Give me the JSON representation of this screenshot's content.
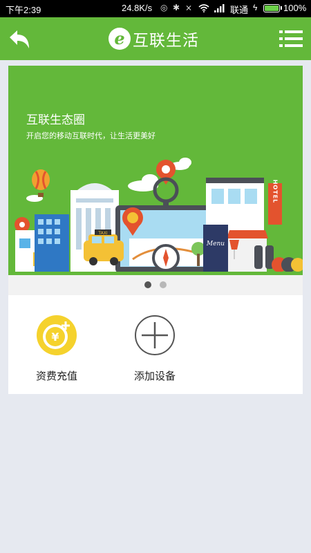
{
  "status_bar": {
    "time": "下午2:39",
    "network_speed": "24.8K/s",
    "carrier": "联通",
    "battery": "100%"
  },
  "header": {
    "title": "互联生活",
    "logo_letter": "e",
    "back_icon": "back-arrow-icon",
    "menu_icon": "list-menu-icon",
    "color": "#63b83a"
  },
  "banner": {
    "title": "互联生态圈",
    "subtitle": "开启您的移动互联时代，让生活更美好",
    "signs": {
      "taxi": "TAXI",
      "hotel": "HOTEL",
      "menu": "Menu"
    },
    "slides_total": 2,
    "slide_active": 1
  },
  "quick_actions": [
    {
      "label": "资费充值",
      "icon": "yuan-coin-icon"
    },
    {
      "label": "添加设备",
      "icon": "add-circle-icon"
    }
  ]
}
